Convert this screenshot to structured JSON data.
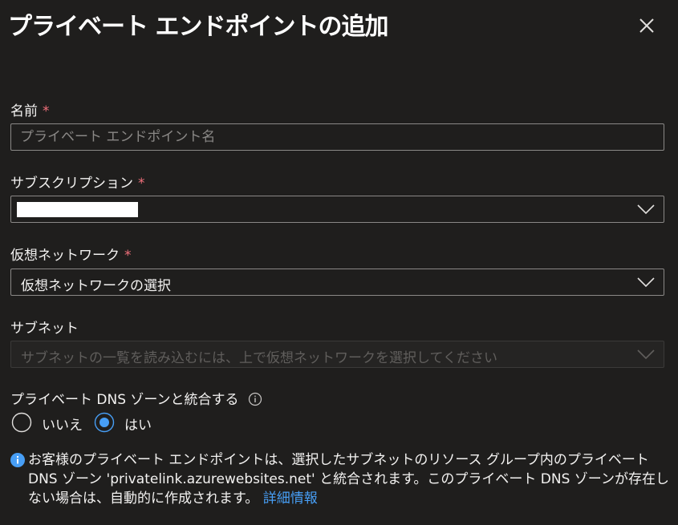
{
  "dialog": {
    "title": "プライベート エンドポイントの追加",
    "close_icon": "close-icon"
  },
  "fields": {
    "name": {
      "label": "名前",
      "required_mark": "*",
      "value": "",
      "placeholder": "プライベート エンドポイント名"
    },
    "subscription": {
      "label": "サブスクリプション",
      "required_mark": "*",
      "value_redacted": true
    },
    "vnet": {
      "label": "仮想ネットワーク",
      "required_mark": "*",
      "value": "仮想ネットワークの選択"
    },
    "subnet": {
      "label": "サブネット",
      "placeholder": "サブネットの一覧を読み込むには、上で仮想ネットワークを選択してください",
      "disabled": true
    },
    "dns": {
      "label": "プライベート DNS ゾーンと統合する",
      "info_icon": "info-icon",
      "options": [
        "いいえ",
        "はい"
      ],
      "selected": "はい"
    }
  },
  "info": {
    "icon": "info-icon",
    "line1": "お客様のプライベート エンドポイントは、選択したサブネットのリソース グループ内のプライベート DNS ゾーン 'privatelink.azurewebsites.net' と統合されます。このプライベート DNS ゾーンが存在しない場合は、自動的に作成されます。",
    "link": "詳細情報"
  },
  "colors": {
    "accent": "#479ef5",
    "required": "#f1707b",
    "background": "#1f1e1d"
  }
}
